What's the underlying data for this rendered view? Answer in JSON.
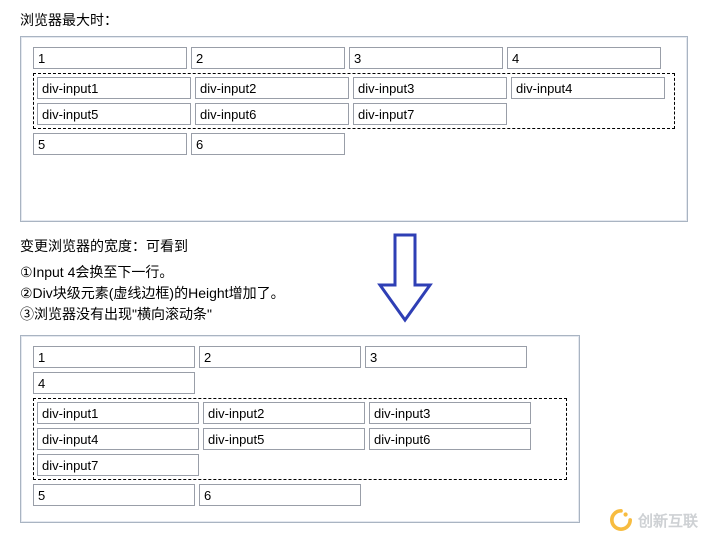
{
  "titles": {
    "maxBrowser": "浏览器最大时：",
    "resizeBrowser": "变更浏览器的宽度：可看到",
    "note1": "①Input 4会换至下一行。",
    "note2": "②Div块级元素(虚线边框)的Height增加了。",
    "note3": "③浏览器没有出现\"横向滚动条\""
  },
  "wide": {
    "row1": [
      "1",
      "2",
      "3",
      "4"
    ],
    "divRow1": [
      "div-input1",
      "div-input2",
      "div-input3",
      "div-input4"
    ],
    "divRow2": [
      "div-input5",
      "div-input6",
      "div-input7"
    ],
    "row3": [
      "5",
      "6"
    ]
  },
  "narrow": {
    "row1": [
      "1",
      "2",
      "3"
    ],
    "row1b": [
      "4"
    ],
    "divRow1": [
      "div-input1",
      "div-input2",
      "div-input3"
    ],
    "divRow2": [
      "div-input4",
      "div-input5",
      "div-input6"
    ],
    "divRow3": [
      "div-input7"
    ],
    "row3": [
      "5",
      "6"
    ]
  },
  "watermark": "创新互联"
}
